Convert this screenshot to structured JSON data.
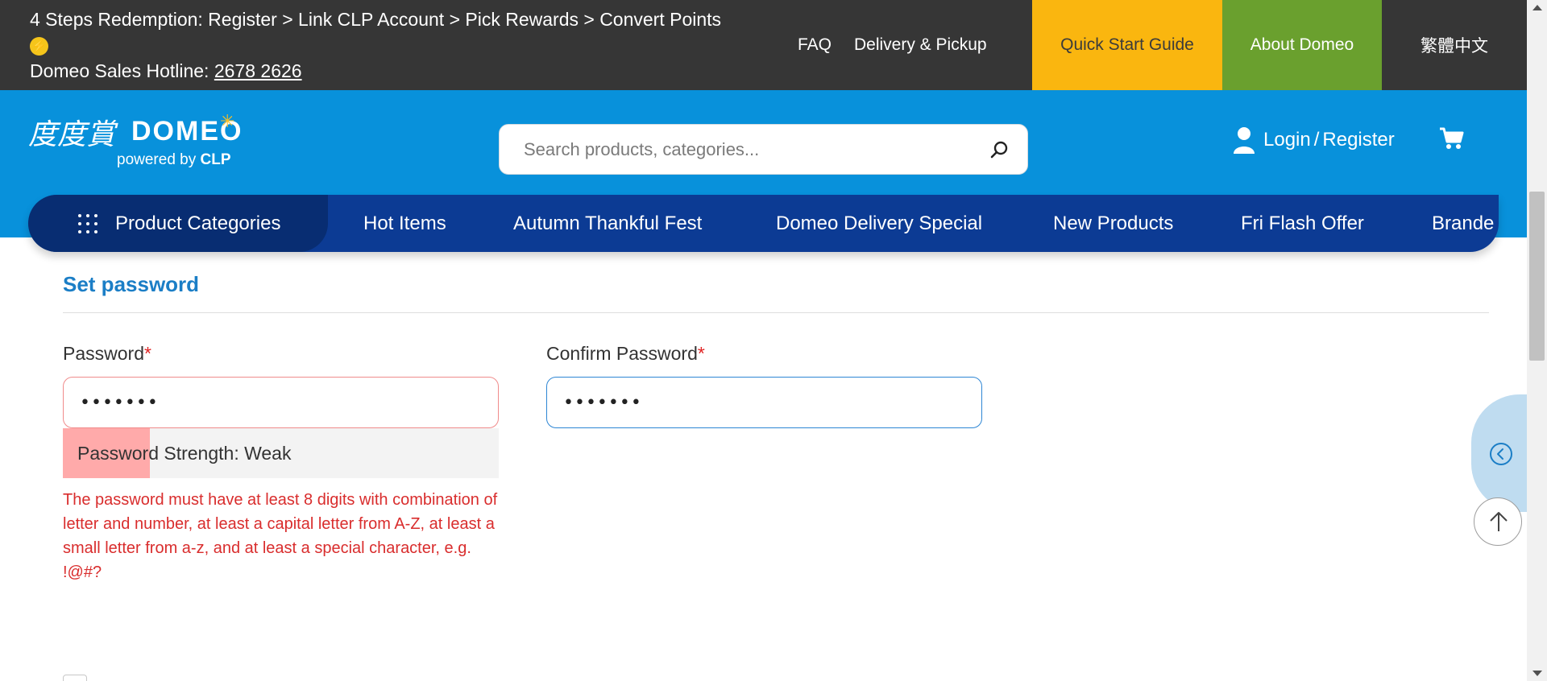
{
  "topbar": {
    "promo_text": "4 Steps Redemption: Register > Link CLP Account > Pick Rewards > Convert Points",
    "promo_icon": "lightning-icon",
    "hotline_label": "Domeo Sales Hotline: ",
    "hotline_number": "2678 2626",
    "faq": "FAQ",
    "delivery": "Delivery & Pickup",
    "quick_start": "Quick Start Guide",
    "about": "About Domeo",
    "language": "繁體中文",
    "colors": {
      "background": "#363636",
      "quick_start_bg": "#fab60f",
      "about_bg": "#6aa02e"
    }
  },
  "header": {
    "logo": {
      "chinese": "度度賞",
      "english": "DOMEO",
      "powered_prefix": "powered by ",
      "powered_brand": "CLP"
    },
    "search_placeholder": "Search products, categories...",
    "search_icon": "search-icon",
    "login": "Login",
    "separator": "/",
    "register": "Register",
    "user_icon": "user-icon",
    "cart_icon": "cart-icon",
    "colors": {
      "background": "#0891db"
    }
  },
  "nav": {
    "categories_label": "Product Categories",
    "items": [
      "Hot Items",
      "Autumn Thankful Fest",
      "Domeo Delivery Special",
      "New Products",
      "Fri Flash Offer",
      "Brande"
    ],
    "colors": {
      "background": "#0c3b94",
      "categories_bg": "#082d72"
    }
  },
  "form": {
    "section_title": "Set password",
    "password_label": "Password",
    "confirm_label": "Confirm Password",
    "required_mark": "*",
    "password_value": "•••••••",
    "confirm_value": "•••••••",
    "strength_text": "Password Strength: Weak",
    "strength_level": 0.2,
    "error_message": "The password must have at least 8 digits with combination of letter and number, at least a capital letter from A-Z, at least a small letter from a-z, and at least a special character, e.g. !@#?",
    "colors": {
      "title": "#1b7ec6",
      "error": "#d92d2d",
      "strength_weak": "#ffaaaa"
    }
  },
  "side": {
    "expand_icon": "chevron-left-circle-icon",
    "top_icon": "arrow-up-icon"
  }
}
